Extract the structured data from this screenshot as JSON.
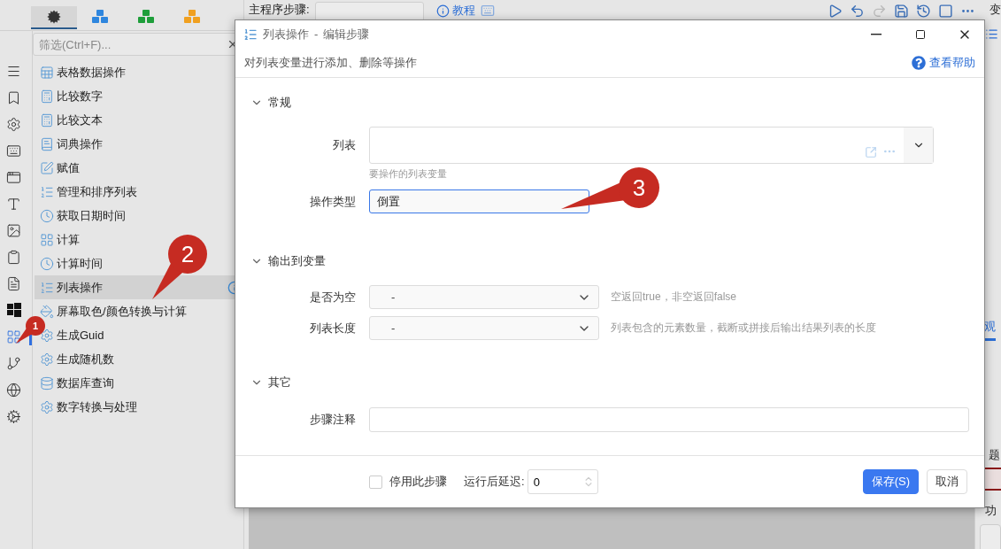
{
  "panel_tabs": [
    {
      "kind": "gears",
      "color": "#333333",
      "selected": true
    },
    {
      "kind": "cubes",
      "color": "#2e86de",
      "selected": false
    },
    {
      "kind": "cubes",
      "color": "#1e9e3a",
      "selected": false
    },
    {
      "kind": "cubes",
      "color": "#f0a020",
      "selected": false
    }
  ],
  "rail": [
    {
      "kind": "menu",
      "selected": false
    },
    {
      "kind": "bookmark",
      "selected": false
    },
    {
      "kind": "gear",
      "selected": false
    },
    {
      "kind": "keyboard",
      "selected": false
    },
    {
      "kind": "window",
      "selected": false
    },
    {
      "kind": "letter",
      "selected": false
    },
    {
      "kind": "image",
      "selected": false
    },
    {
      "kind": "clipboard",
      "selected": false
    },
    {
      "kind": "document",
      "selected": false
    },
    {
      "kind": "windows",
      "selected": false
    },
    {
      "kind": "grid",
      "selected": true
    },
    {
      "kind": "branch",
      "selected": false
    },
    {
      "kind": "globe",
      "selected": false
    },
    {
      "kind": "gears",
      "selected": false
    }
  ],
  "filter": {
    "placeholder": "筛选(Ctrl+F)..."
  },
  "items": [
    {
      "label": "表格数据操作",
      "kind": "table",
      "selected": false
    },
    {
      "label": "比较数字",
      "kind": "calculator",
      "selected": false
    },
    {
      "label": "比较文本",
      "kind": "calculator",
      "selected": false
    },
    {
      "label": "词典操作",
      "kind": "book",
      "selected": false
    },
    {
      "label": "赋值",
      "kind": "pen",
      "selected": false
    },
    {
      "label": "管理和排序列表",
      "kind": "list",
      "selected": false
    },
    {
      "label": "获取日期时间",
      "kind": "clock",
      "selected": false
    },
    {
      "label": "计算",
      "kind": "grid",
      "selected": false
    },
    {
      "label": "计算时间",
      "kind": "clock",
      "selected": false
    },
    {
      "label": "列表操作",
      "kind": "list",
      "selected": true
    },
    {
      "label": "屏幕取色/颜色转换与计算",
      "kind": "bucket",
      "selected": false
    },
    {
      "label": "生成Guid",
      "kind": "gear",
      "selected": false
    },
    {
      "label": "生成随机数",
      "kind": "gear",
      "selected": false
    },
    {
      "label": "数据库查询",
      "kind": "database",
      "selected": false
    },
    {
      "label": "数字转换与处理",
      "kind": "gear",
      "selected": false
    }
  ],
  "toolbar": {
    "label": "主程序步骤:",
    "link": "教程",
    "side_label": "变"
  },
  "right_panel": {
    "tab": "观",
    "heading": "题",
    "label": "功"
  },
  "dialog": {
    "title": "列表操作",
    "separator": "-",
    "subtitle": "编辑步骤",
    "description": "对列表变量进行添加、删除等操作",
    "help": "查看帮助",
    "sections": [
      {
        "title": "常规",
        "expanded": true,
        "fields": [
          {
            "kind": "variable",
            "label": "列表",
            "hint": "要操作的列表变量"
          },
          {
            "kind": "select",
            "label": "操作类型",
            "value": "倒置",
            "focused": true
          }
        ]
      },
      {
        "title": "输出到变量",
        "expanded": true,
        "fields": [
          {
            "kind": "output",
            "label": "是否为空",
            "value": "-",
            "note": "空返回true，非空返回false"
          },
          {
            "kind": "output",
            "label": "列表长度",
            "value": "-",
            "note": "列表包含的元素数量，截断或拼接后输出结果列表的长度"
          }
        ]
      },
      {
        "title": "其它",
        "expanded": true,
        "fields": [
          {
            "kind": "text",
            "label": "步骤注释"
          }
        ]
      }
    ],
    "footer": {
      "disable_label": "停用此步骤",
      "disabled": false,
      "delay_label": "运行后延迟:",
      "delay_value": "0",
      "save": "保存(S)",
      "cancel": "取消"
    }
  },
  "callouts": [
    {
      "number": "1"
    },
    {
      "number": "2"
    },
    {
      "number": "3"
    }
  ]
}
